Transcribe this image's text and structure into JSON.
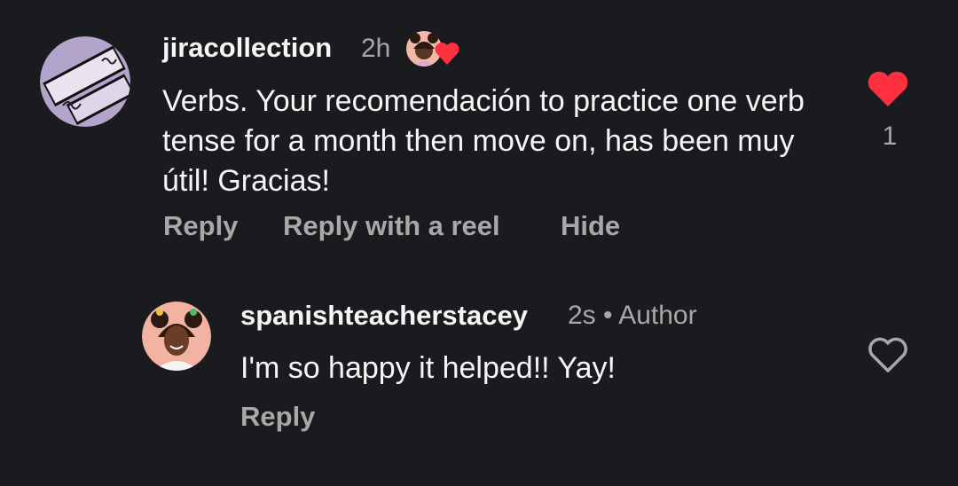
{
  "comments": [
    {
      "username": "jiracollection",
      "time": "2h",
      "text": "Verbs. Your recomendación to practice one verb tense for a month then move on, has been muy útil! Gracias!",
      "actions": {
        "reply": "Reply",
        "reply_reel": "Reply with a reel",
        "hide": "Hide"
      },
      "liked": true,
      "like_count": "1",
      "creator_liked_badge": true
    },
    {
      "username": "spanishteacherstacey",
      "meta": "2s • Author",
      "text": "I'm  so happy it helped!! Yay!",
      "actions": {
        "reply": "Reply"
      },
      "liked": false
    }
  ],
  "colors": {
    "background": "#1a1b1f",
    "primary_text": "#f5f5f5",
    "secondary_text": "#a8a8a8",
    "like_red": "#ff3040"
  }
}
